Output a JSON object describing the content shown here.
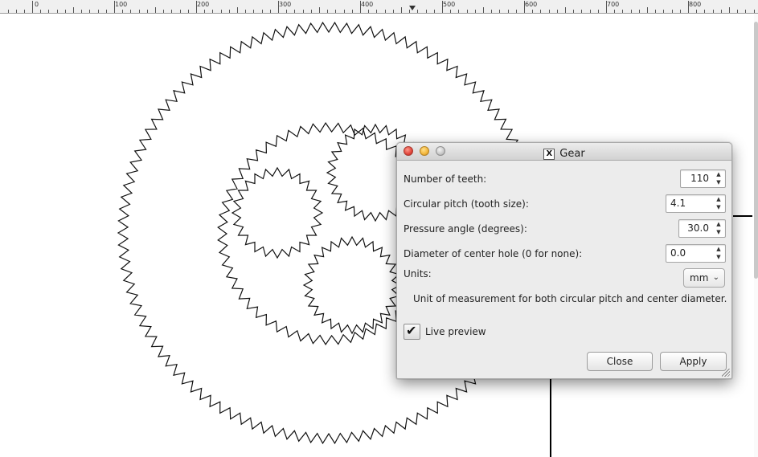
{
  "ruler": {
    "labels": [
      "0",
      "100",
      "200",
      "300",
      "400",
      "500",
      "600",
      "700",
      "800"
    ]
  },
  "dialog": {
    "title": "Gear",
    "fields": [
      {
        "label": "Number of teeth:",
        "value": "110"
      },
      {
        "label": "Circular pitch (tooth size):",
        "value": "4.1"
      },
      {
        "label": "Pressure angle (degrees):",
        "value": "30.0"
      },
      {
        "label": "Diameter of center hole (0 for none):",
        "value": "0.0"
      }
    ],
    "units": {
      "label": "Units:",
      "value": "mm",
      "help": "Unit of measurement for both circular pitch and center diameter."
    },
    "live_preview": {
      "label": "Live preview",
      "checked": true
    },
    "buttons": {
      "close": "Close",
      "apply": "Apply"
    }
  },
  "icons": {
    "window_icon": "x-icon",
    "spin_up": "chevron-up-icon",
    "spin_down": "chevron-down-icon",
    "select": "chevron-updown-icon",
    "check": "checkmark-icon"
  },
  "colors": {
    "dialog_bg": "#ececec",
    "canvas_bg": "#ffffff",
    "close_dot": "#e0443a",
    "min_dot": "#f2b53a",
    "max_dot": "#c7c7c7"
  }
}
